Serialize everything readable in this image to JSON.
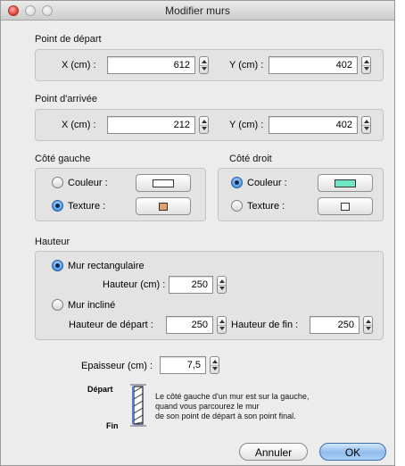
{
  "window": {
    "title": "Modifier murs"
  },
  "start_point": {
    "heading": "Point de départ",
    "x_label": "X (cm) :",
    "x_value": "612",
    "y_label": "Y (cm) :",
    "y_value": "402"
  },
  "end_point": {
    "heading": "Point d'arrivée",
    "x_label": "X (cm) :",
    "x_value": "212",
    "y_label": "Y (cm) :",
    "y_value": "402"
  },
  "left_side": {
    "heading": "Côté gauche",
    "color_label": "Couleur :",
    "texture_label": "Texture :",
    "selected": "texture",
    "color_swatch": "#ffffff",
    "texture_swatch": "#e0a070"
  },
  "right_side": {
    "heading": "Côté droit",
    "color_label": "Couleur :",
    "texture_label": "Texture :",
    "selected": "color",
    "color_swatch": "#6fe6c4",
    "texture_swatch": "#ffffff"
  },
  "height": {
    "heading": "Hauteur",
    "rect_label": "Mur rectangulaire",
    "rect_height_label": "Hauteur (cm) :",
    "rect_height_value": "250",
    "inclined_label": "Mur incliné",
    "start_height_label": "Hauteur de départ :",
    "start_height_value": "250",
    "end_height_label": "Hauteur de fin :",
    "end_height_value": "250",
    "selected": "rectangular"
  },
  "thickness": {
    "label": "Epaisseur (cm) :",
    "value": "7,5"
  },
  "legend": {
    "start_label": "Départ",
    "end_label": "Fin",
    "line1": "Le côté gauche d'un mur est sur la gauche,",
    "line2": "quand vous parcourez le mur",
    "line3": "de son point de départ à son point final."
  },
  "buttons": {
    "cancel": "Annuler",
    "ok": "OK"
  },
  "icons": {
    "close": "close-icon",
    "minimize": "minimize-icon",
    "zoom": "zoom-icon",
    "stepper": "stepper-icon",
    "wall_diagram": "wall-direction-icon"
  }
}
